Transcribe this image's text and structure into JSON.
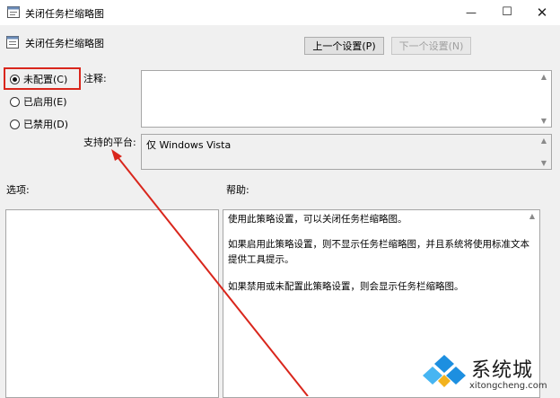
{
  "window": {
    "title": "关闭任务栏缩略图",
    "controls": [
      "minimize-icon",
      "maximize-icon",
      "close-icon"
    ]
  },
  "header": {
    "policy_name": "关闭任务栏缩略图",
    "prev_button": "上一个设置(P)",
    "next_button": "下一个设置(N)"
  },
  "state_options": [
    {
      "label": "未配置(C)",
      "checked": true
    },
    {
      "label": "已启用(E)",
      "checked": false
    },
    {
      "label": "已禁用(D)",
      "checked": false
    }
  ],
  "comment": {
    "label": "注释:",
    "value": ""
  },
  "platform": {
    "label": "支持的平台:",
    "value": "仅 Windows Vista"
  },
  "options": {
    "label": "选项:"
  },
  "help": {
    "label": "帮助:",
    "paragraphs": [
      "使用此策略设置，可以关闭任务栏缩略图。",
      "如果启用此策略设置，则不显示任务栏缩略图，并且系统将使用标准文本提供工具提示。",
      "如果禁用或未配置此策略设置，则会显示任务栏缩略图。"
    ]
  },
  "watermark": {
    "brand_cn": "系统城",
    "brand_en": "xitongcheng.com"
  },
  "colors": {
    "highlight": "#d9261c",
    "annotation_arrow": "#d9261c",
    "logo_blue": "#1d8fe0"
  }
}
